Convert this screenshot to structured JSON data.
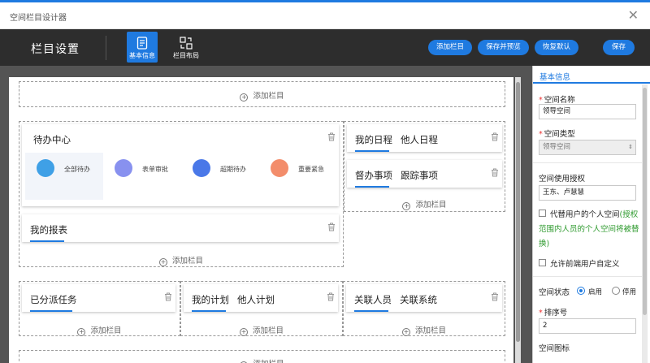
{
  "window": {
    "title": "空间栏目设计器",
    "close_icon": "close-icon"
  },
  "toolbar": {
    "heading": "栏目设置",
    "tabs": [
      {
        "label": "基本信息",
        "icon": "document-icon",
        "active": true
      },
      {
        "label": "栏目布局",
        "icon": "layout-icon",
        "active": false
      }
    ],
    "buttons": {
      "add_column": "添加栏目",
      "save_preview": "保存并预览",
      "restore_default": "恢复默认",
      "save": "保存"
    }
  },
  "canvas": {
    "add_column": "添加栏目",
    "cards": {
      "todo": {
        "title": "待办中心",
        "items": [
          {
            "label": "全部待办",
            "color": "#3fa0e6"
          },
          {
            "label": "表单审批",
            "color": "#8891ef"
          },
          {
            "label": "超期待办",
            "color": "#4a78e8"
          },
          {
            "label": "重要紧急",
            "color": "#f38d6b"
          }
        ]
      },
      "schedule": {
        "tabs": [
          "我的日程",
          "他人日程"
        ]
      },
      "supervise": {
        "tabs": [
          "督办事项",
          "跟踪事项"
        ]
      },
      "report": {
        "tabs": [
          "我的报表"
        ]
      },
      "tasks": {
        "tabs": [
          "已分派任务"
        ]
      },
      "plan": {
        "tabs": [
          "我的计划",
          "他人计划"
        ]
      },
      "contacts": {
        "tabs": [
          "关联人员",
          "关联系统"
        ]
      }
    }
  },
  "panel": {
    "header": "基本信息",
    "name_label": "空间名称",
    "name_value": "领导空间",
    "type_label": "空间类型",
    "type_value": "领导空间",
    "auth_label": "空间使用授权",
    "auth_value": "王东、卢慧慧",
    "replace_label": "代替用户的个人空间",
    "replace_note_a": "(授权",
    "replace_note_b": "范围内人员的个人空间将被替",
    "replace_note_c": "换)",
    "custom_label": "允许前端用户自定义",
    "status_label": "空间状态",
    "status_on": "启用",
    "status_off": "停用",
    "order_label": "排序号",
    "order_value": "2",
    "icon_label": "空间图标"
  }
}
